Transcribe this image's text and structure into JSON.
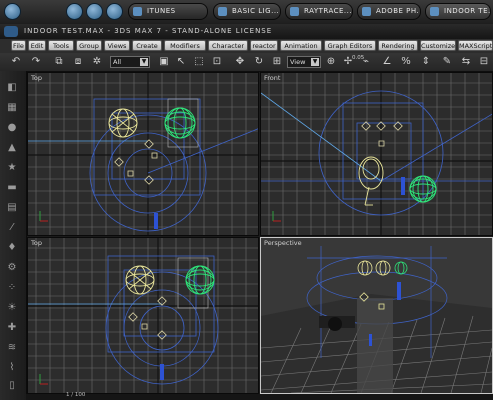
{
  "taskbar": {
    "tasks": [
      {
        "label": "ITUNES"
      },
      {
        "label": "BASIC LIG..."
      },
      {
        "label": "RAYTRACE..."
      },
      {
        "label": "ADOBE PH..."
      },
      {
        "label": "INDOOR TE..."
      }
    ]
  },
  "window": {
    "title": "INDOOR TEST.MAX - 3DS MAX 7 - STAND-ALONE LICENSE"
  },
  "menu": {
    "items": [
      "File",
      "Edit",
      "Tools",
      "Group",
      "Views",
      "Create",
      "Modifiers",
      "Character",
      "reactor",
      "Animation",
      "Graph Editors",
      "Rendering",
      "Customize",
      "MAXScript"
    ]
  },
  "toolbar": {
    "selection_filter": "All",
    "reference_coord": "View",
    "snap_value": "0.05"
  },
  "viewports": {
    "top_left": {
      "label": "Top"
    },
    "top_right": {
      "label": "Front"
    },
    "bottom_left": {
      "label": "Top"
    },
    "bottom_right": {
      "label": "Perspective"
    }
  },
  "status": {
    "frame": "1 / 100"
  },
  "colors": {
    "grid": "#6d6d6d",
    "wire_blue": "#3f63c8",
    "wire_green": "#2ee57a",
    "wire_yellow": "#e9e59a",
    "light_cyan": "#5fa8e8"
  }
}
